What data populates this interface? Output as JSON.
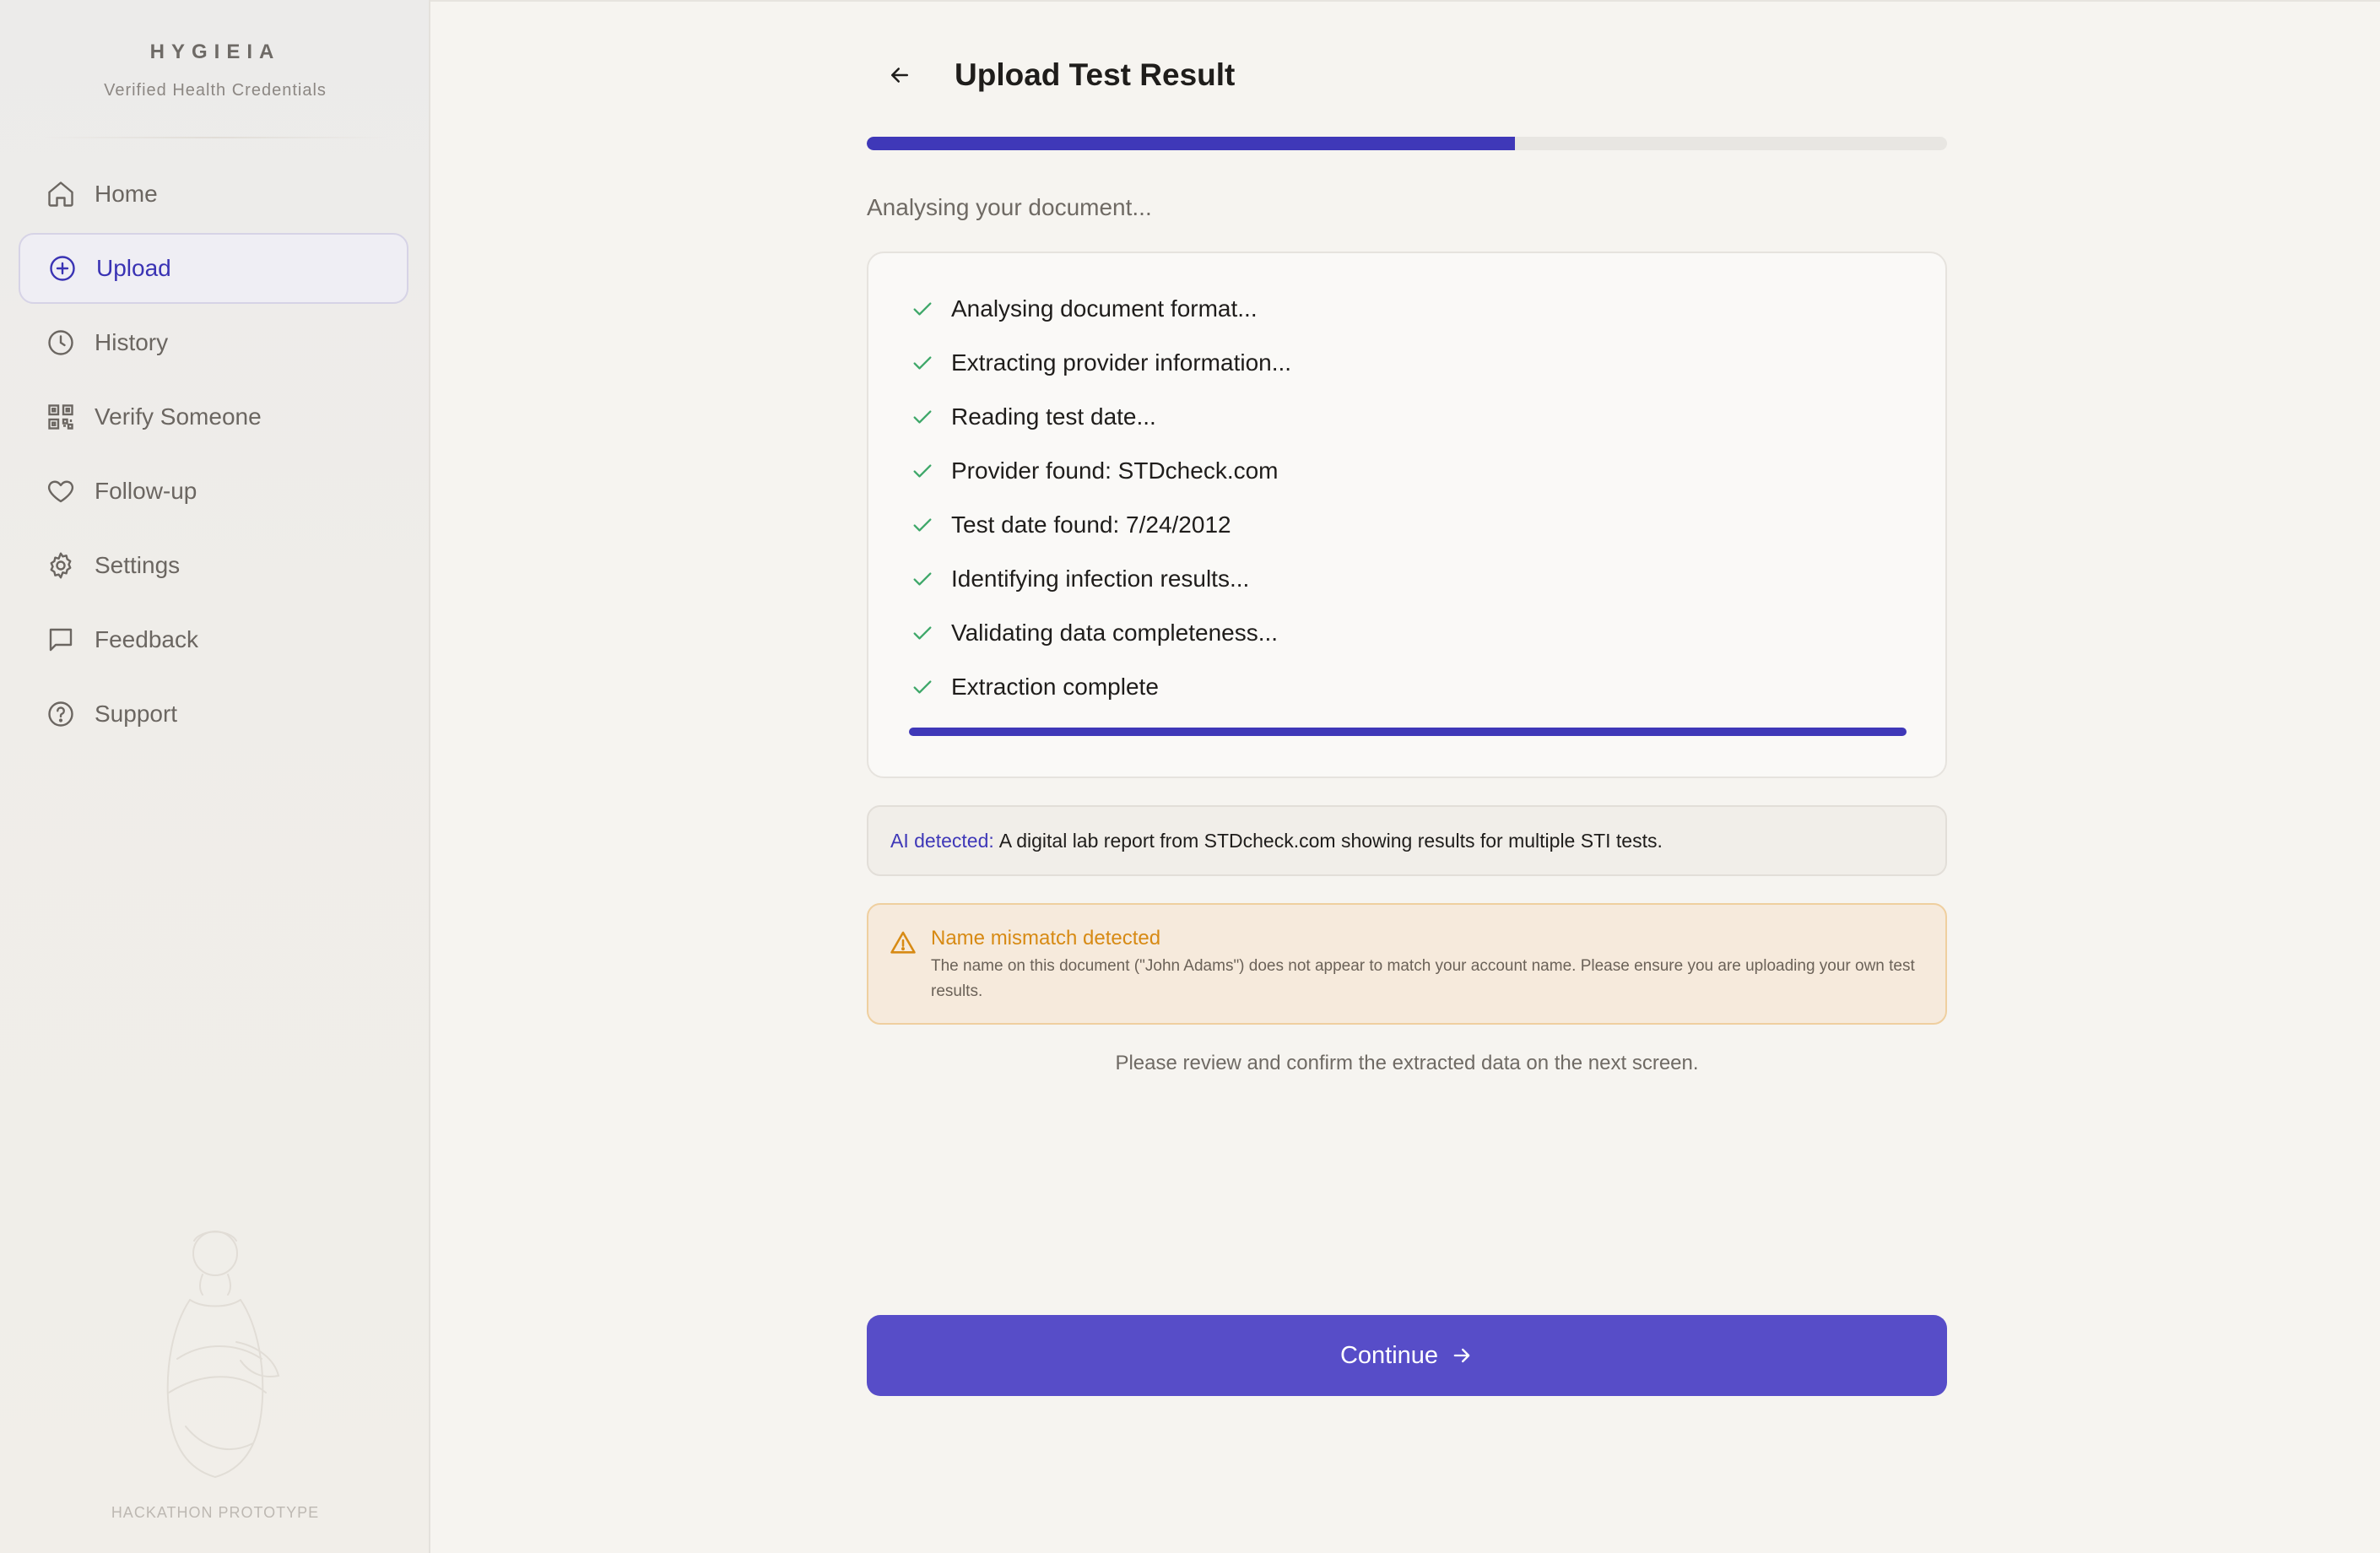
{
  "brand": {
    "title": "HYGIEIA",
    "subtitle": "Verified Health Credentials",
    "footer": "HACKATHON PROTOTYPE"
  },
  "sidebar": {
    "items": [
      {
        "label": "Home",
        "icon": "home-icon",
        "active": false
      },
      {
        "label": "Upload",
        "icon": "plus-circle-icon",
        "active": true
      },
      {
        "label": "History",
        "icon": "clock-icon",
        "active": false
      },
      {
        "label": "Verify Someone",
        "icon": "qr-code-icon",
        "active": false
      },
      {
        "label": "Follow-up",
        "icon": "heart-icon",
        "active": false
      },
      {
        "label": "Settings",
        "icon": "gear-icon",
        "active": false
      },
      {
        "label": "Feedback",
        "icon": "message-icon",
        "active": false
      },
      {
        "label": "Support",
        "icon": "help-circle-icon",
        "active": false
      }
    ]
  },
  "header": {
    "title": "Upload Test Result"
  },
  "progress": {
    "value": 0.6
  },
  "status": {
    "text": "Analysing your document..."
  },
  "steps": [
    "Analysing document format...",
    "Extracting provider information...",
    "Reading test date...",
    "Provider found: STDcheck.com",
    "Test date found: 7/24/2012",
    "Identifying infection results...",
    "Validating data completeness...",
    "Extraction complete"
  ],
  "steps_progress": 1.0,
  "ai_detected": {
    "label": "AI detected:",
    "text": "A digital lab report from STDcheck.com showing results for multiple STI tests."
  },
  "warning": {
    "title": "Name mismatch detected",
    "body": "The name on this document (\"John Adams\") does not appear to match your account name. Please ensure you are uploading your own test results."
  },
  "review_note": "Please review and confirm the extracted data on the next screen.",
  "continue_label": "Continue",
  "colors": {
    "accent": "#3f38b8",
    "button": "#574dc8",
    "success": "#3fa86a",
    "warning": "#d78a14"
  }
}
